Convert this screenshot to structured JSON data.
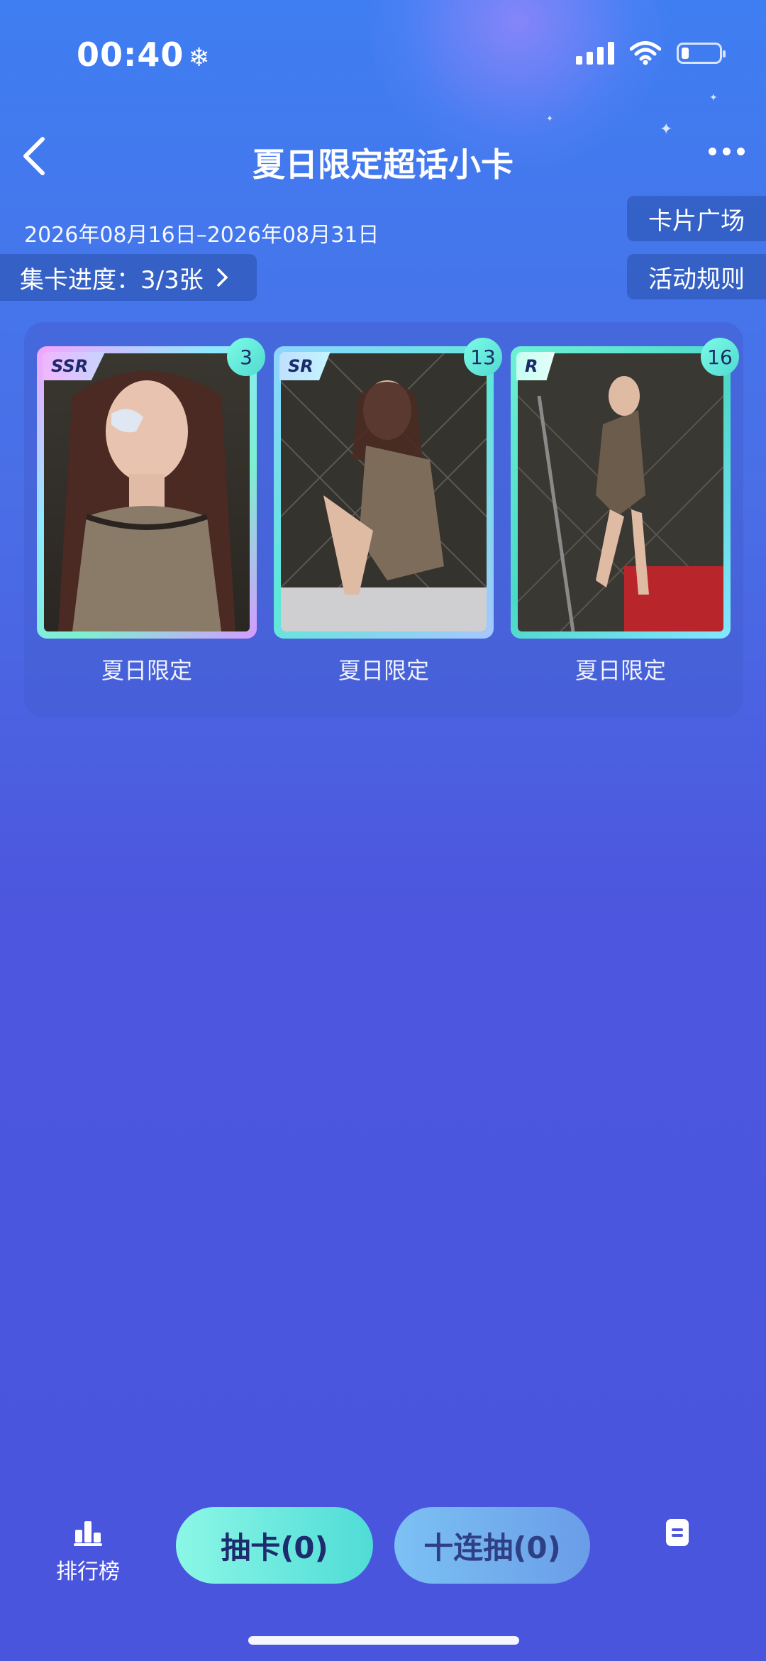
{
  "status_bar": {
    "time": "00:40",
    "time_icon": "snowflake-icon"
  },
  "header": {
    "title": "夏日限定超话小卡"
  },
  "event": {
    "date_range": "2026年08月16日–2026年08月31日"
  },
  "progress": {
    "label": "集卡进度：3/3张"
  },
  "side_buttons": {
    "card_square": "卡片广场",
    "rules": "活动规则"
  },
  "cards": [
    {
      "rarity": "SSR",
      "count": "3",
      "label": "夏日限定"
    },
    {
      "rarity": "SR",
      "count": "13",
      "label": "夏日限定"
    },
    {
      "rarity": "R",
      "count": "16",
      "label": "夏日限定"
    }
  ],
  "bottom_bar": {
    "rank_label": "排行榜",
    "draw_label": "抽卡(0)",
    "draw10_label": "十连抽(0)"
  },
  "colors": {
    "accent": "#4fdcd6",
    "background": "#4a55de"
  }
}
